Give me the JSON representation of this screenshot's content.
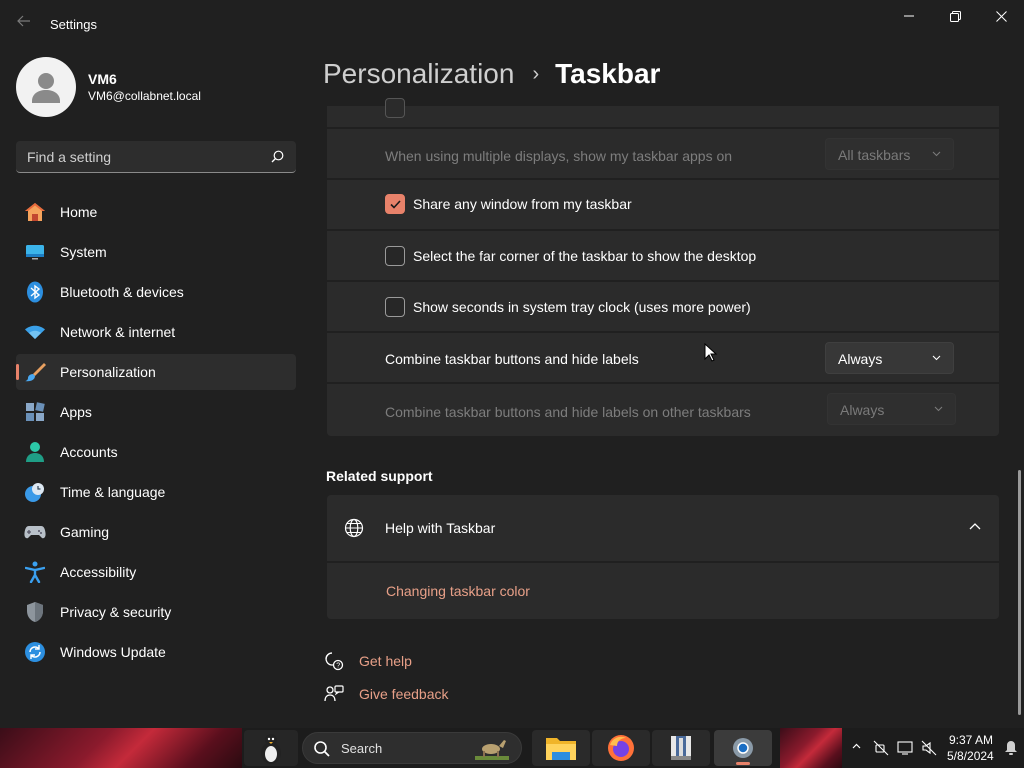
{
  "window": {
    "title": "Settings"
  },
  "profile": {
    "name": "VM6",
    "email": "VM6@collabnet.local"
  },
  "search": {
    "placeholder": "Find a setting"
  },
  "nav": {
    "items": [
      {
        "label": "Home",
        "icon": "home-icon"
      },
      {
        "label": "System",
        "icon": "system-icon"
      },
      {
        "label": "Bluetooth & devices",
        "icon": "bluetooth-icon"
      },
      {
        "label": "Network & internet",
        "icon": "network-icon"
      },
      {
        "label": "Personalization",
        "icon": "brush-icon",
        "active": true
      },
      {
        "label": "Apps",
        "icon": "apps-icon"
      },
      {
        "label": "Accounts",
        "icon": "accounts-icon"
      },
      {
        "label": "Time & language",
        "icon": "clock-globe-icon"
      },
      {
        "label": "Gaming",
        "icon": "gamepad-icon"
      },
      {
        "label": "Accessibility",
        "icon": "accessibility-icon"
      },
      {
        "label": "Privacy & security",
        "icon": "shield-icon"
      },
      {
        "label": "Windows Update",
        "icon": "update-icon"
      }
    ]
  },
  "breadcrumb": {
    "parent": "Personalization",
    "separator": "›",
    "current": "Taskbar"
  },
  "settings": {
    "multi_display_label": "When using multiple displays, show my taskbar apps on",
    "multi_display_value": "All taskbars",
    "share_window_label": "Share any window from my taskbar",
    "share_window_checked": true,
    "far_corner_label": "Select the far corner of the taskbar to show the desktop",
    "far_corner_checked": false,
    "show_seconds_label": "Show seconds in system tray clock (uses more power)",
    "show_seconds_checked": false,
    "combine_label": "Combine taskbar buttons and hide labels",
    "combine_value": "Always",
    "combine_other_label": "Combine taskbar buttons and hide labels on other taskbars",
    "combine_other_value": "Always"
  },
  "related": {
    "title": "Related support",
    "help_title": "Help with Taskbar",
    "link": "Changing taskbar color"
  },
  "help_links": {
    "get_help": "Get help",
    "give_feedback": "Give feedback"
  },
  "taskbar": {
    "search_label": "Search",
    "time": "9:37 AM",
    "date": "5/8/2024"
  },
  "colors": {
    "accent": "#e8826a",
    "background": "#202020",
    "card": "#2b2b2b"
  }
}
